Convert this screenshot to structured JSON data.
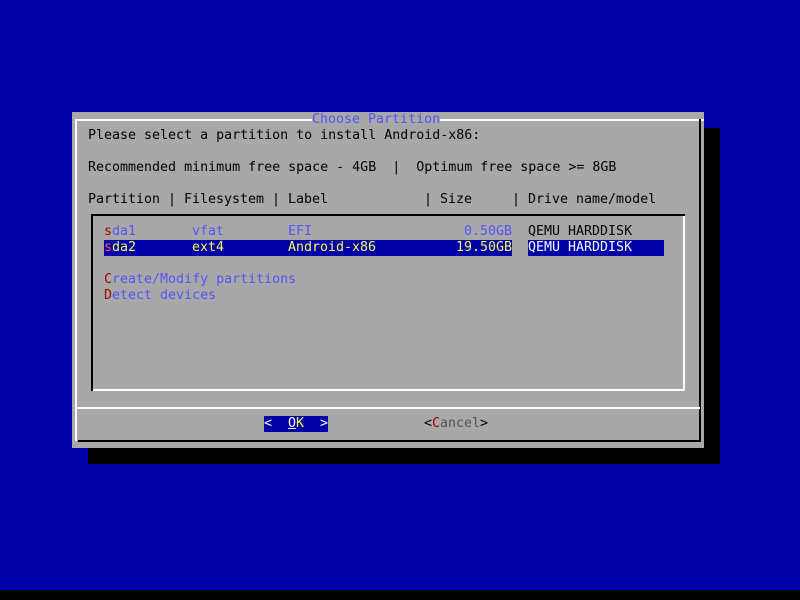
{
  "dialog": {
    "title": "Choose Partition",
    "prompt": "Please select a partition to install Android-x86:",
    "space_info": "Recommended minimum free space - 4GB  |  Optimum free space >= 8GB",
    "columns": {
      "partition": "Partition",
      "filesystem": "Filesystem",
      "label": "Label",
      "size": "Size",
      "drive": "Drive name/model",
      "sep": "|"
    },
    "partitions": [
      {
        "hotkey": "s",
        "rest": "da1",
        "filesystem": "vfat",
        "label": "EFI",
        "size": "0.50GB",
        "drive": "QEMU HARDDISK",
        "selected": false
      },
      {
        "hotkey": "s",
        "rest": "da2",
        "filesystem": "ext4",
        "label": "Android-x86",
        "size": "19.50GB",
        "drive": "QEMU HARDDISK",
        "selected": true
      }
    ],
    "actions": [
      {
        "hotkey": "C",
        "rest": "reate/Modify partitions"
      },
      {
        "hotkey": "D",
        "rest": "etect devices"
      }
    ],
    "buttons": {
      "ok": {
        "lt": "<",
        "hotkey": "O",
        "rest": "K",
        "gt": ">",
        "focused": true
      },
      "cancel": {
        "lt": "<",
        "hotkey": "C",
        "rest": "ancel",
        "gt": ">"
      }
    }
  },
  "colors": {
    "background": "#0000a8",
    "dialog": "#a8a8a8",
    "accent_text": "#5454fc",
    "hotkey": "#a80000",
    "highlight_text": "#fcfc54"
  }
}
